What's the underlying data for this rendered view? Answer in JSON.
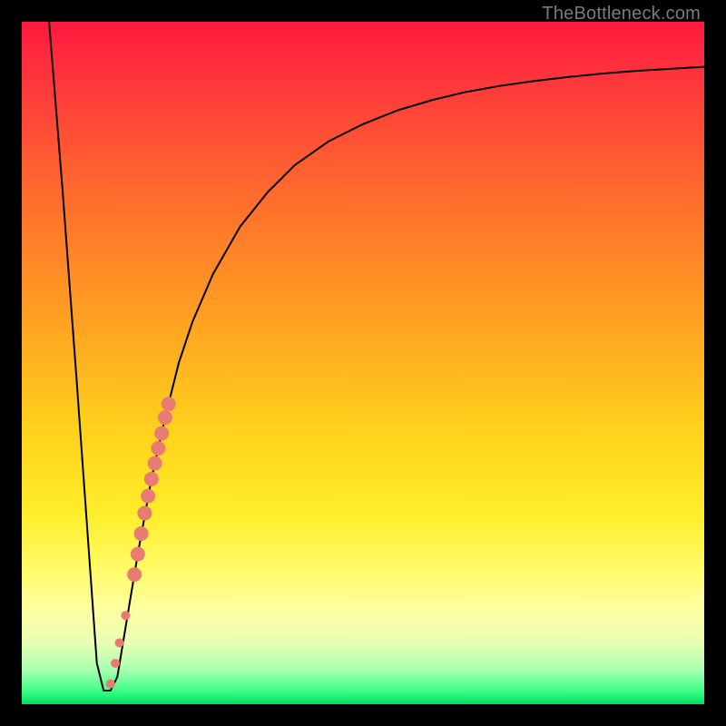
{
  "attribution": "TheBottleneck.com",
  "chart_data": {
    "type": "line",
    "title": "",
    "xlabel": "",
    "ylabel": "",
    "xlim": [
      0,
      100
    ],
    "ylim": [
      0,
      100
    ],
    "series": [
      {
        "name": "bottleneck-curve",
        "x": [
          4,
          6,
          8,
          10,
          11,
          12,
          13,
          14,
          15,
          17,
          19,
          21,
          23,
          25,
          28,
          32,
          36,
          40,
          45,
          50,
          55,
          60,
          65,
          70,
          75,
          80,
          85,
          90,
          95,
          100
        ],
        "y": [
          100,
          75,
          48,
          20,
          6,
          2,
          2,
          4,
          10,
          22,
          33,
          42,
          50,
          56,
          63,
          70,
          75,
          79,
          82.5,
          85,
          87,
          88.5,
          89.7,
          90.6,
          91.3,
          91.9,
          92.4,
          92.8,
          93.1,
          93.4
        ]
      }
    ],
    "markers": {
      "name": "highlight-band",
      "color": "#e97c72",
      "points": [
        {
          "x": 13.0,
          "y": 3.0,
          "r": 5
        },
        {
          "x": 13.7,
          "y": 6.0,
          "r": 5
        },
        {
          "x": 14.3,
          "y": 9.0,
          "r": 5
        },
        {
          "x": 15.2,
          "y": 13.0,
          "r": 5
        },
        {
          "x": 16.5,
          "y": 19.0,
          "r": 8
        },
        {
          "x": 17.0,
          "y": 22.0,
          "r": 8
        },
        {
          "x": 17.5,
          "y": 25.0,
          "r": 8
        },
        {
          "x": 18.0,
          "y": 28.0,
          "r": 8
        },
        {
          "x": 18.5,
          "y": 30.5,
          "r": 8
        },
        {
          "x": 19.0,
          "y": 33.0,
          "r": 8
        },
        {
          "x": 19.5,
          "y": 35.3,
          "r": 8
        },
        {
          "x": 20.0,
          "y": 37.5,
          "r": 8
        },
        {
          "x": 20.5,
          "y": 39.7,
          "r": 8
        },
        {
          "x": 21.0,
          "y": 42.0,
          "r": 8
        },
        {
          "x": 21.5,
          "y": 44.0,
          "r": 8
        }
      ]
    }
  }
}
